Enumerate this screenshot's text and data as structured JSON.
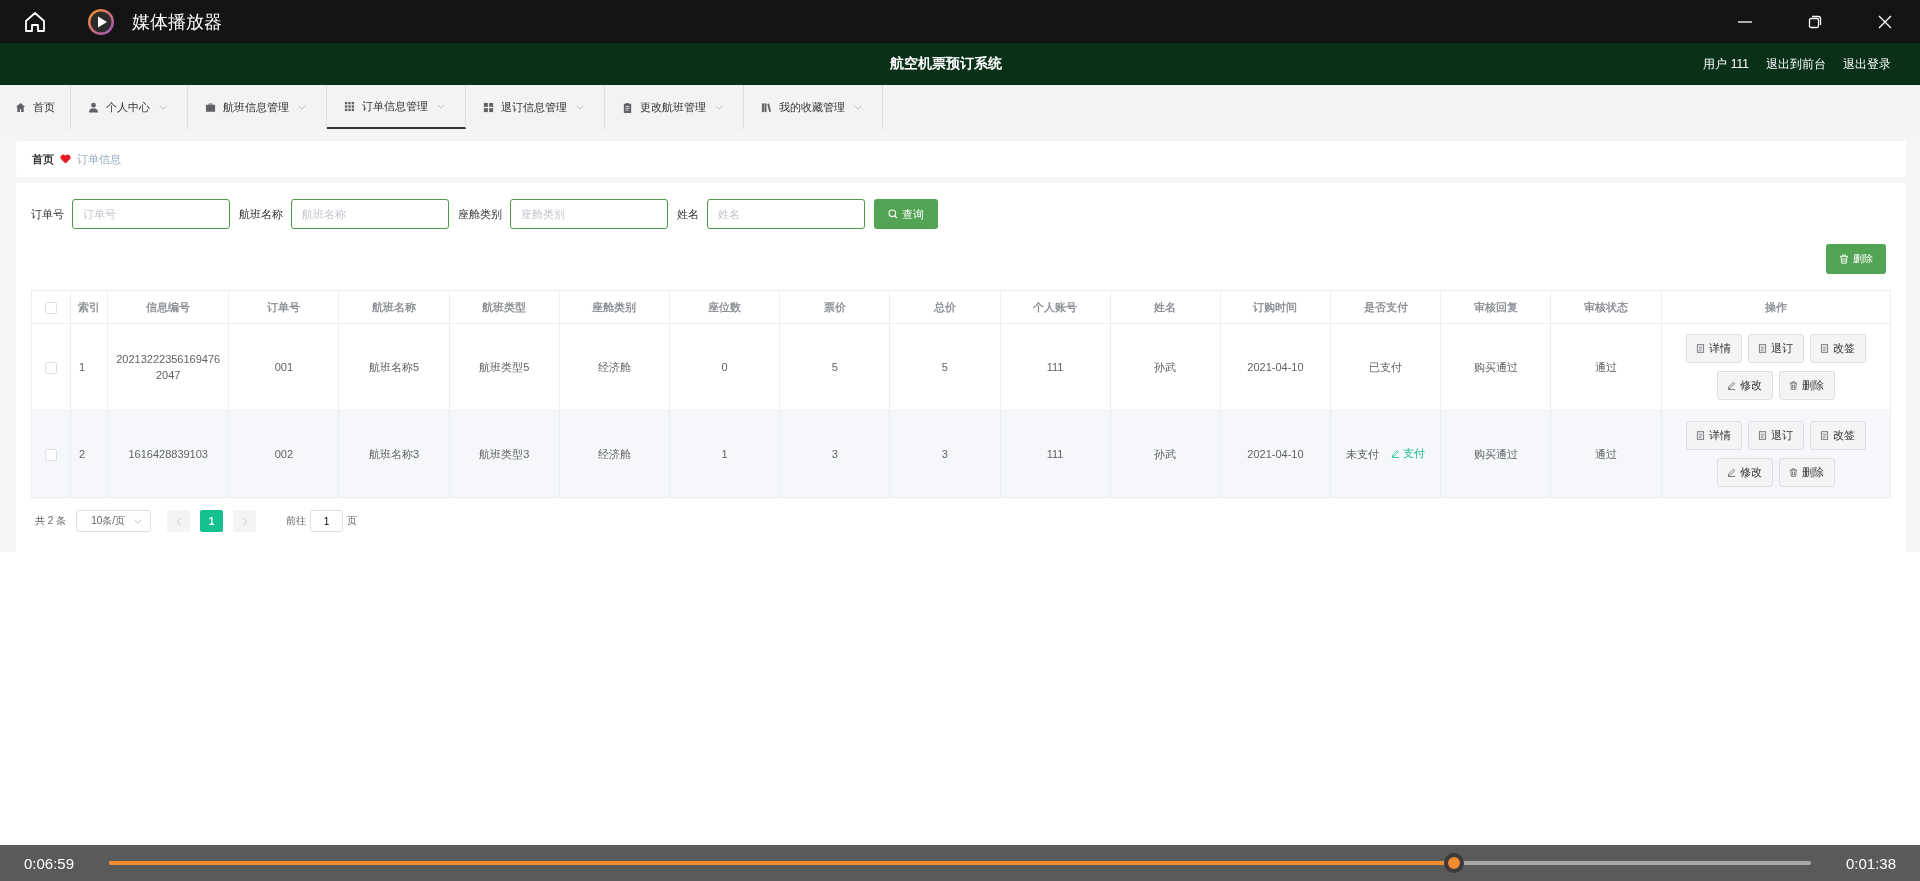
{
  "player": {
    "title": "媒体播放器",
    "current_time": "0:06:59",
    "remaining_time": "0:01:38",
    "level": 0.79
  },
  "header": {
    "title": "航空机票预订系统",
    "links": [
      "用户 111",
      "退出到前台",
      "退出登录"
    ]
  },
  "nav": [
    {
      "label": "首页",
      "dropdown": false,
      "selected": false
    },
    {
      "label": "个人中心",
      "dropdown": true,
      "selected": false
    },
    {
      "label": "航班信息管理",
      "dropdown": true,
      "selected": false
    },
    {
      "label": "订单信息管理",
      "dropdown": true,
      "selected": true
    },
    {
      "label": "退订信息管理",
      "dropdown": true,
      "selected": false
    },
    {
      "label": "更改航班管理",
      "dropdown": true,
      "selected": false
    },
    {
      "label": "我的收藏管理",
      "dropdown": true,
      "selected": false
    }
  ],
  "breadcrumb": [
    "首页",
    "订单信息"
  ],
  "search": {
    "fields": [
      {
        "label": "订单号",
        "placeholder": "订单号"
      },
      {
        "label": "航班名称",
        "placeholder": "航班名称"
      },
      {
        "label": "座舱类别",
        "placeholder": "座舱类别"
      },
      {
        "label": "姓名",
        "placeholder": "姓名"
      }
    ],
    "button": "查询"
  },
  "delete_button": "删除",
  "table": {
    "header_checked": false,
    "columns": [
      "索引",
      "信息编号",
      "订单号",
      "航班名称",
      "航班类型",
      "座舱类别",
      "座位数",
      "票价",
      "总价",
      "个人账号",
      "姓名",
      "订购时间",
      "是否支付",
      "审核回复",
      "审核状态",
      "操作"
    ],
    "rows": [
      {
        "checked": false,
        "cells": [
          "1",
          "20213222356169476 2047",
          "001",
          "航班名称5",
          "航班类型5",
          "经济舱",
          "0",
          "5",
          "5",
          "111",
          "孙武",
          "2021-04-10",
          "已支付",
          "购买通过",
          "通过"
        ],
        "actions": [
          "详情",
          "退订",
          "改签",
          "修改",
          "删除"
        ]
      },
      {
        "checked": false,
        "cells": [
          "2",
          "1616428839103",
          "002",
          "航班名称3",
          "航班类型3",
          "经济舱",
          "1",
          "3",
          "3",
          "111",
          "孙武",
          "2021-04-10",
          "未支付",
          "购买通过",
          "通过"
        ],
        "pay_link": "支付",
        "actions": [
          "详情",
          "退订",
          "改签",
          "修改",
          "删除"
        ]
      }
    ]
  },
  "pagination": {
    "total": "共 2 条",
    "page_size": "10条/页",
    "pages": [
      {
        "label": "1",
        "selected": true
      }
    ],
    "goto_label": "前往",
    "goto_value": "1",
    "goto_suffix": "页"
  }
}
